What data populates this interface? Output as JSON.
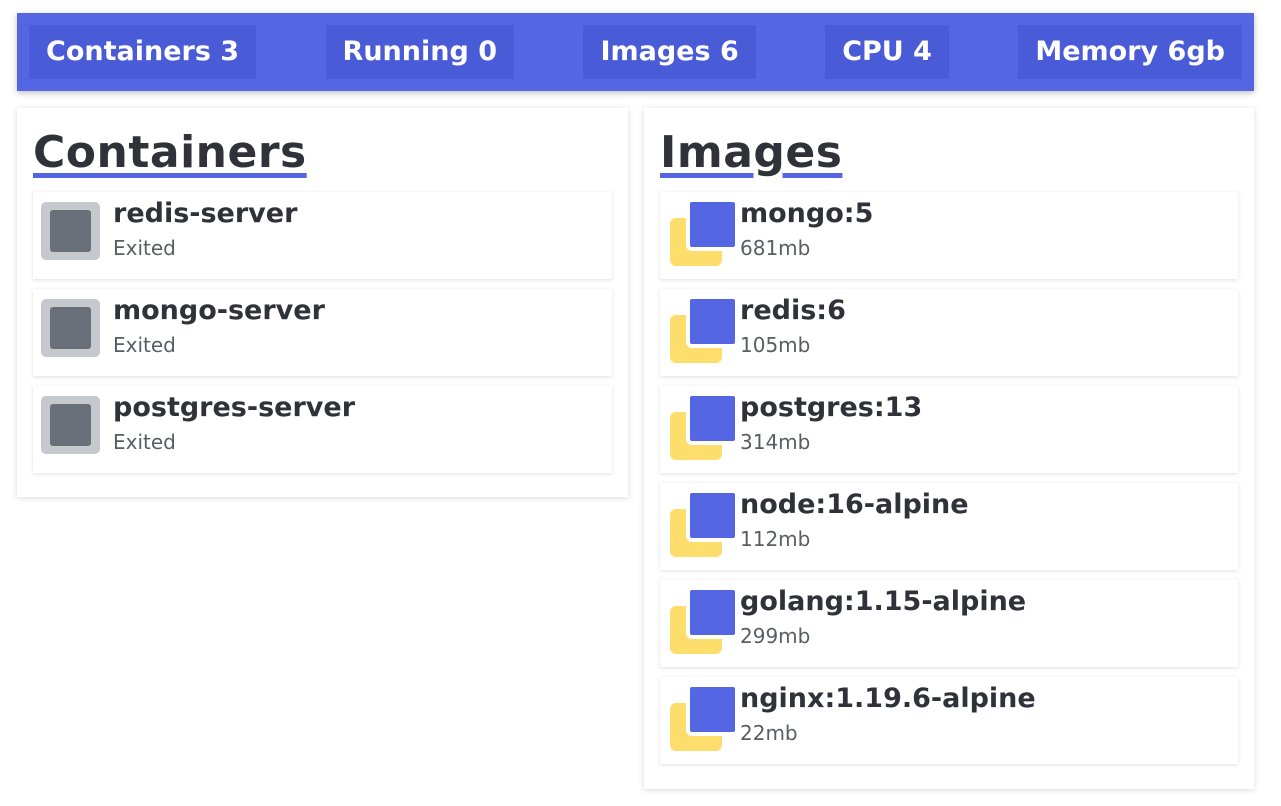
{
  "stats": [
    {
      "label": "Containers 3"
    },
    {
      "label": "Running 0"
    },
    {
      "label": "Images 6"
    },
    {
      "label": "CPU 4"
    },
    {
      "label": "Memory 6gb"
    }
  ],
  "containers": {
    "title": "Containers",
    "items": [
      {
        "name": "redis-server",
        "status": "Exited"
      },
      {
        "name": "mongo-server",
        "status": "Exited"
      },
      {
        "name": "postgres-server",
        "status": "Exited"
      }
    ]
  },
  "images": {
    "title": "Images",
    "items": [
      {
        "name": "mongo:5",
        "size": "681mb"
      },
      {
        "name": "redis:6",
        "size": "105mb"
      },
      {
        "name": "postgres:13",
        "size": "314mb"
      },
      {
        "name": "node:16-alpine",
        "size": "112mb"
      },
      {
        "name": "golang:1.15-alpine",
        "size": "299mb"
      },
      {
        "name": "nginx:1.19.6-alpine",
        "size": "22mb"
      }
    ]
  },
  "colors": {
    "accent": "#5466e4",
    "image_icon_back": "#fddd6b",
    "container_icon": "#6a707a"
  },
  "icons": {
    "container": "container-stopped-icon",
    "image": "image-layers-icon"
  }
}
